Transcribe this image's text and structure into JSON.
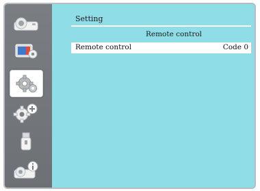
{
  "menu": {
    "title": "Setting",
    "subtitle": "Remote control",
    "rows": [
      {
        "label": "Remote control",
        "value": "Code 0"
      }
    ]
  },
  "sidebar": {
    "items": [
      {
        "icon": "projector-icon",
        "active": false
      },
      {
        "icon": "display-settings-icon",
        "active": false
      },
      {
        "icon": "gear-icon",
        "active": true
      },
      {
        "icon": "gear-plus-icon",
        "active": false
      },
      {
        "icon": "usb-drive-icon",
        "active": false
      },
      {
        "icon": "projector-info-icon",
        "active": false
      }
    ]
  },
  "colors": {
    "panel": "#8fdde6",
    "sidebar": "#737779",
    "highlight": "#ffffff"
  }
}
